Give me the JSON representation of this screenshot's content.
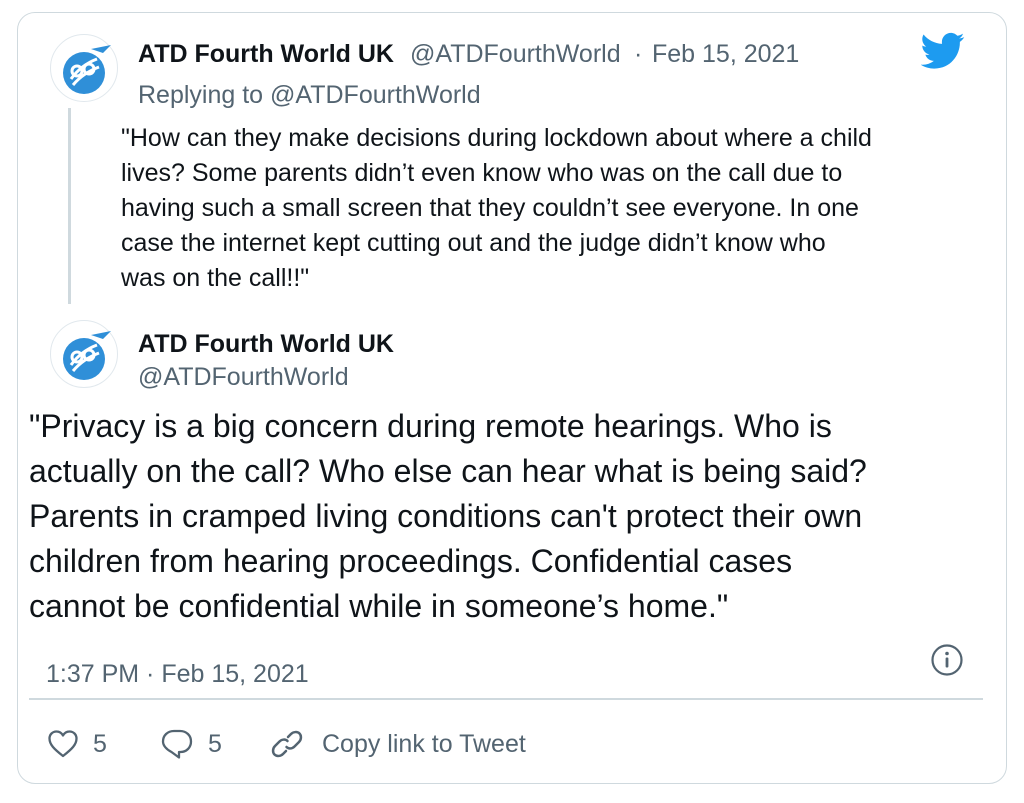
{
  "colors": {
    "twitter_blue": "#1d9bf0",
    "text": "#0f1419",
    "muted": "#536471",
    "border": "#cfd9de"
  },
  "icons": [
    "twitter-logo-icon",
    "avatar-logo-icon",
    "info-icon",
    "heart-icon",
    "reply-icon",
    "link-icon"
  ],
  "quoted_tweet": {
    "author_name": "ATD Fourth World UK",
    "author_handle": "@ATDFourthWorld",
    "separator": "·",
    "date": "Feb 15, 2021",
    "replying_to": "Replying to @ATDFourthWorld",
    "text_lines": [
      "\"How can they make decisions during lockdown about where a child",
      "lives? Some parents didn’t even know who was on the call due to",
      "having such a small screen that they couldn’t see everyone. In one",
      "case the internet kept cutting out and the judge didn’t know who",
      "was on the call!!\""
    ]
  },
  "main_tweet": {
    "author_name": "ATD Fourth World UK",
    "author_handle": "@ATDFourthWorld",
    "text_lines": [
      "\"Privacy is a big concern during remote hearings. Who is",
      "actually on the call? Who else can hear what is being said?",
      "Parents in cramped living conditions can't protect their own",
      "children from hearing proceedings. Confidential cases",
      "cannot be confidential while in someone’s home.\""
    ],
    "timestamp": "1:37 PM · Feb 15, 2021"
  },
  "actions": {
    "like_count": "5",
    "reply_count": "5",
    "copy_link_label": "Copy link to Tweet"
  }
}
